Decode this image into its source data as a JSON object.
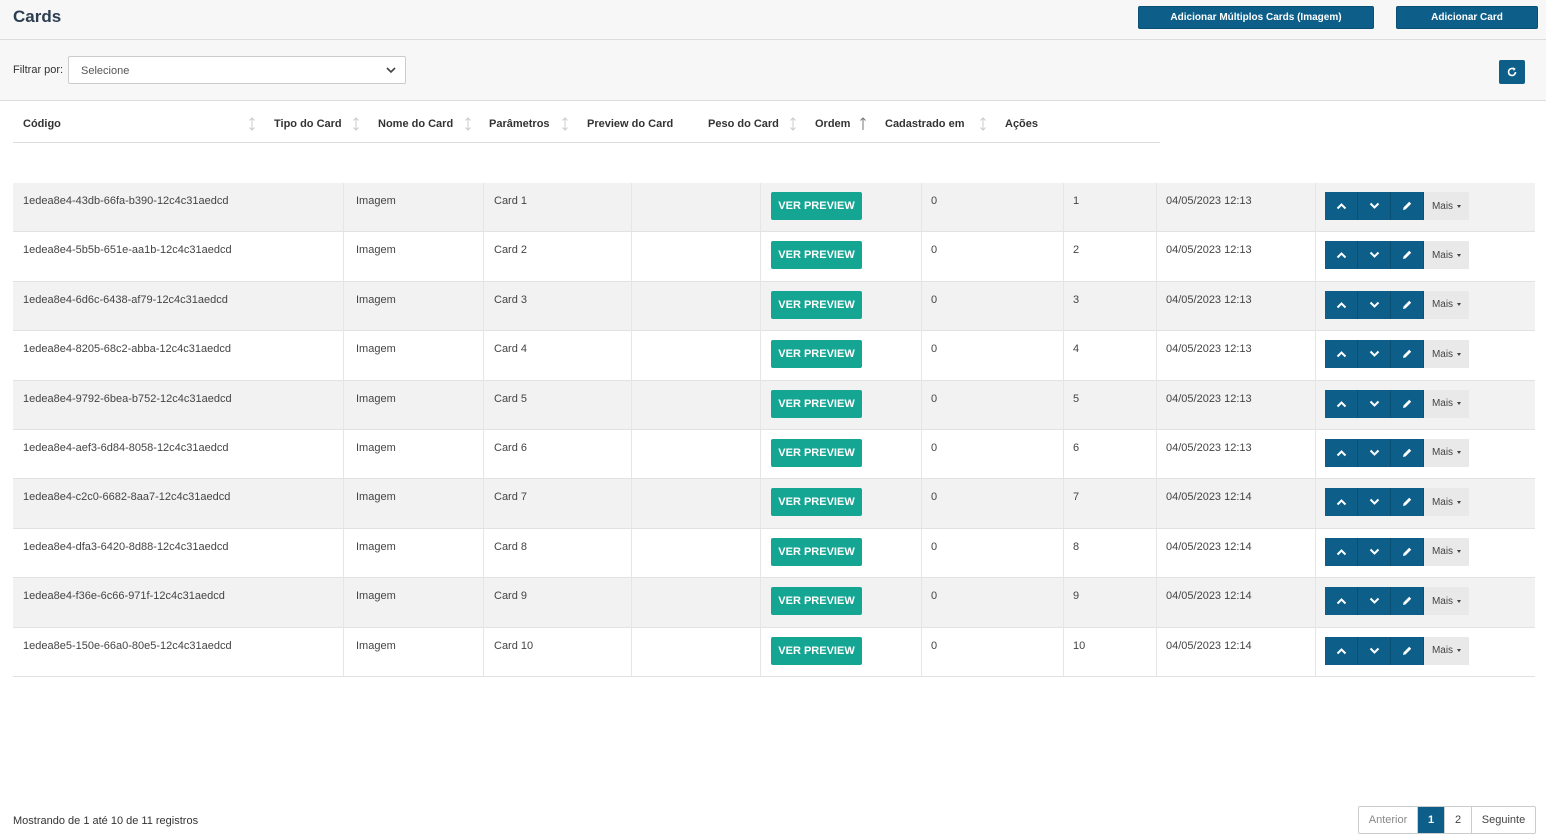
{
  "header": {
    "title": "Cards",
    "btn_multi": "Adicionar Múltiplos Cards (Imagem)",
    "btn_add": "Adicionar Card"
  },
  "filter": {
    "label": "Filtrar por:",
    "selected": "Selecione"
  },
  "columns": [
    "Código",
    "Tipo do Card",
    "Nome do Card",
    "Parâmetros",
    "Preview do Card",
    "Peso do Card",
    "Ordem",
    "Cadastrado em",
    "Ações"
  ],
  "rows": [
    {
      "codigo": "1edea8e4-43db-66fa-b390-12c4c31aedcd",
      "tipo": "Imagem",
      "nome": "Card 1",
      "parametros": "",
      "preview": "VER PREVIEW",
      "peso": "0",
      "ordem": "1",
      "cadastrado": "04/05/2023 12:13"
    },
    {
      "codigo": "1edea8e4-5b5b-651e-aa1b-12c4c31aedcd",
      "tipo": "Imagem",
      "nome": "Card 2",
      "parametros": "",
      "preview": "VER PREVIEW",
      "peso": "0",
      "ordem": "2",
      "cadastrado": "04/05/2023 12:13"
    },
    {
      "codigo": "1edea8e4-6d6c-6438-af79-12c4c31aedcd",
      "tipo": "Imagem",
      "nome": "Card 3",
      "parametros": "",
      "preview": "VER PREVIEW",
      "peso": "0",
      "ordem": "3",
      "cadastrado": "04/05/2023 12:13"
    },
    {
      "codigo": "1edea8e4-8205-68c2-abba-12c4c31aedcd",
      "tipo": "Imagem",
      "nome": "Card 4",
      "parametros": "",
      "preview": "VER PREVIEW",
      "peso": "0",
      "ordem": "4",
      "cadastrado": "04/05/2023 12:13"
    },
    {
      "codigo": "1edea8e4-9792-6bea-b752-12c4c31aedcd",
      "tipo": "Imagem",
      "nome": "Card 5",
      "parametros": "",
      "preview": "VER PREVIEW",
      "peso": "0",
      "ordem": "5",
      "cadastrado": "04/05/2023 12:13"
    },
    {
      "codigo": "1edea8e4-aef3-6d84-8058-12c4c31aedcd",
      "tipo": "Imagem",
      "nome": "Card 6",
      "parametros": "",
      "preview": "VER PREVIEW",
      "peso": "0",
      "ordem": "6",
      "cadastrado": "04/05/2023 12:13"
    },
    {
      "codigo": "1edea8e4-c2c0-6682-8aa7-12c4c31aedcd",
      "tipo": "Imagem",
      "nome": "Card 7",
      "parametros": "",
      "preview": "VER PREVIEW",
      "peso": "0",
      "ordem": "7",
      "cadastrado": "04/05/2023 12:14"
    },
    {
      "codigo": "1edea8e4-dfa3-6420-8d88-12c4c31aedcd",
      "tipo": "Imagem",
      "nome": "Card 8",
      "parametros": "",
      "preview": "VER PREVIEW",
      "peso": "0",
      "ordem": "8",
      "cadastrado": "04/05/2023 12:14"
    },
    {
      "codigo": "1edea8e4-f36e-6c66-971f-12c4c31aedcd",
      "tipo": "Imagem",
      "nome": "Card 9",
      "parametros": "",
      "preview": "VER PREVIEW",
      "peso": "0",
      "ordem": "9",
      "cadastrado": "04/05/2023 12:14"
    },
    {
      "codigo": "1edea8e5-150e-66a0-80e5-12c4c31aedcd",
      "tipo": "Imagem",
      "nome": "Card 10",
      "parametros": "",
      "preview": "VER PREVIEW",
      "peso": "0",
      "ordem": "10",
      "cadastrado": "04/05/2023 12:14"
    }
  ],
  "row_actions": {
    "mais_label": "Mais"
  },
  "footer": {
    "info": "Mostrando de 1 até 10 de 11 registros"
  },
  "pagination": {
    "prev": "Anterior",
    "pages": [
      "1",
      "2"
    ],
    "next": "Seguinte",
    "active": "1"
  },
  "colors": {
    "primary": "#0d5f8a",
    "preview": "#14a693"
  },
  "icons": [
    "chevron-up-icon",
    "chevron-down-icon",
    "pencil-icon",
    "refresh-icon",
    "caret-down-icon",
    "sort-icon",
    "sort-asc-icon"
  ]
}
